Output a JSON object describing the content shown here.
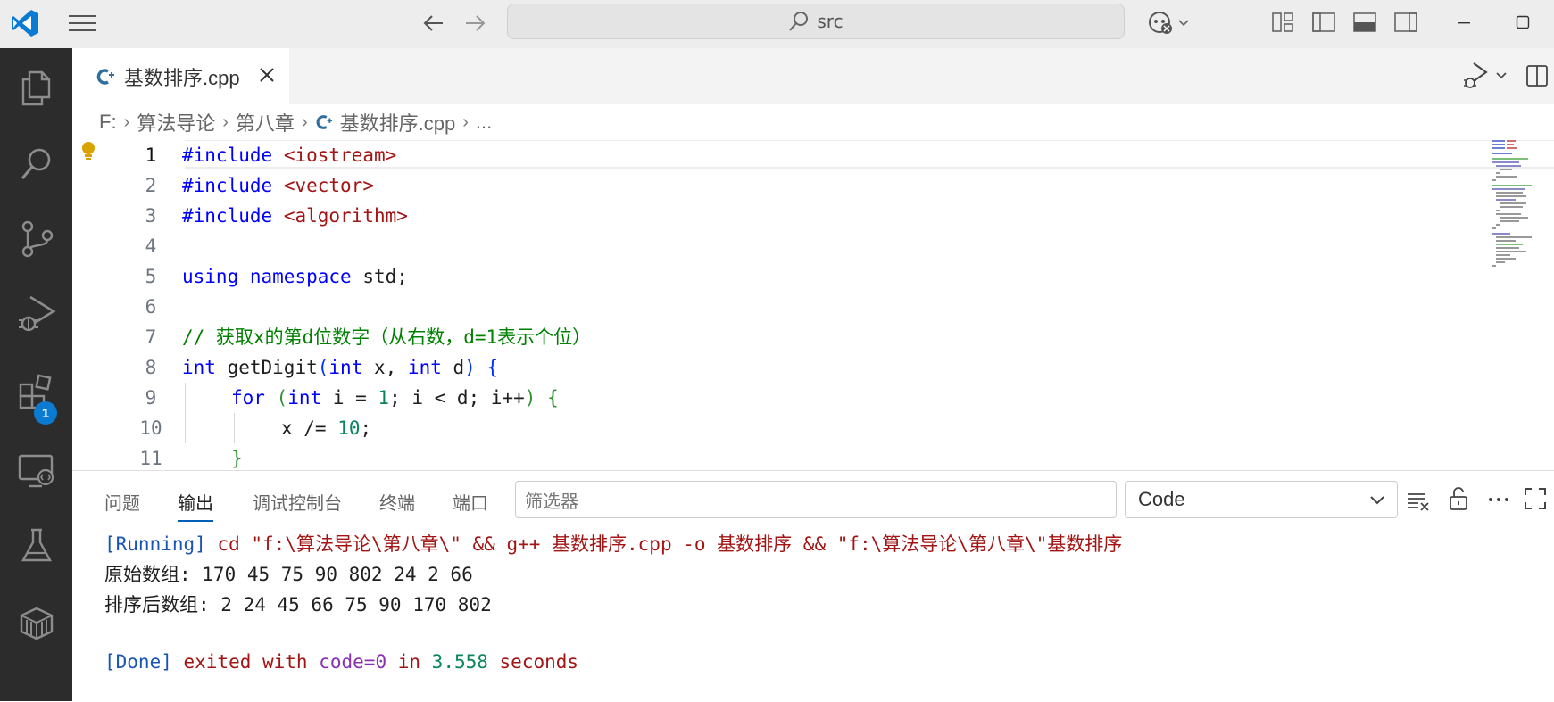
{
  "titlebar": {
    "search_text": "src"
  },
  "activity_bar": {
    "extensions_badge": "1"
  },
  "tabs": [
    {
      "label": "基数排序.cpp"
    }
  ],
  "breadcrumb": {
    "drive": "F:",
    "folder1": "算法导论",
    "folder2": "第八章",
    "file": "基数排序.cpp",
    "more": "..."
  },
  "editor": {
    "line_numbers": [
      "1",
      "2",
      "3",
      "4",
      "5",
      "6",
      "7",
      "8",
      "9",
      "10",
      "11"
    ],
    "lines": {
      "l1_kw": "#include",
      "l1_str": "<iostream>",
      "l2_kw": "#include",
      "l2_str": "<vector>",
      "l3_kw": "#include",
      "l3_str": "<algorithm>",
      "l5_kw1": "using",
      "l5_kw2": "namespace",
      "l5_rest": "std;",
      "l7_comment": "// 获取x的第d位数字（从右数，d=1表示个位）",
      "l8_kw": "int",
      "l8_fn": "getDigit",
      "l8_p1": "(",
      "l8_kw2": "int",
      "l8_a": " x, ",
      "l8_kw3": "int",
      "l8_b": " d",
      "l8_p2": ")",
      "l8_brace": "{",
      "l9_kw": "for",
      "l9_p1": "(",
      "l9_kw2": "int",
      "l9_a": " i = ",
      "l9_num": "1",
      "l9_b": "; i < d; i++",
      "l9_p2": ")",
      "l9_brace": "{",
      "l10_a": "x /= ",
      "l10_num": "10",
      "l10_b": ";",
      "l11_brace": "}"
    }
  },
  "panel": {
    "tabs": [
      "问题",
      "输出",
      "调试控制台",
      "终端",
      "端口"
    ],
    "filter_placeholder": "筛选器",
    "channel_select": "Code",
    "output": {
      "running_tag": "[Running]",
      "running_cmd": " cd \"f:\\算法导论\\第八章\\\" && g++ 基数排序.cpp -o 基数排序 && \"f:\\算法导论\\第八章\\\"基数排序",
      "line2": "原始数组: 170 45 75 90 802 24 2 66",
      "line3": "排序后数组: 2 24 45 66 75 90 170 802",
      "done_tag": "[Done]",
      "done_exited": " exited with ",
      "done_code": "code=0",
      "done_in": " in ",
      "done_seconds_num": "3.558",
      "done_seconds": " seconds"
    }
  }
}
